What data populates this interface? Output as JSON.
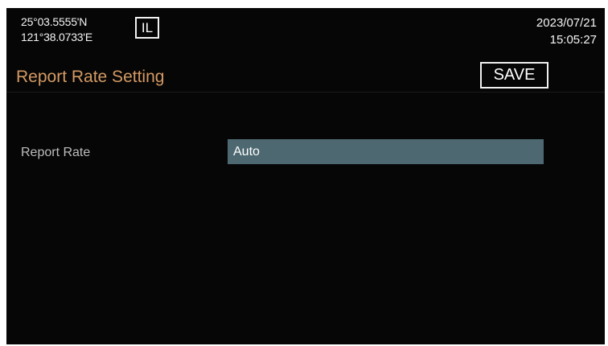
{
  "status": {
    "latitude": "25°03.5555'N",
    "longitude": "121°38.0733'E",
    "mode": "IL",
    "date": "2023/07/21",
    "time": "15:05:27"
  },
  "header": {
    "title": "Report Rate Setting",
    "save_label": "SAVE"
  },
  "settings": [
    {
      "label": "Report Rate",
      "value": "Auto"
    }
  ],
  "colors": {
    "screen_background": "#060606",
    "title_text": "#d39a63",
    "label_text": "#bdbdbd",
    "selected_field": "#4d6871",
    "button_border": "#f0f0f0"
  }
}
